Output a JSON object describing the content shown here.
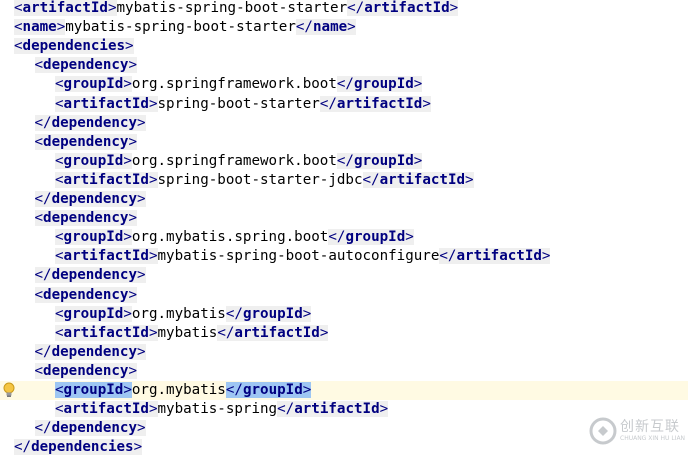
{
  "editor": {
    "lines": [
      {
        "indent": 0,
        "open": "artifactId",
        "text": "mybatis-spring-boot-starter",
        "close": "artifactId"
      },
      {
        "indent": 0,
        "open": "name",
        "text": "mybatis-spring-boot-starter",
        "close": "name"
      },
      {
        "indent": 0,
        "open": "dependencies"
      },
      {
        "indent": 1,
        "open": "dependency"
      },
      {
        "indent": 2,
        "open": "groupId",
        "text": "org.springframework.boot",
        "close": "groupId"
      },
      {
        "indent": 2,
        "open": "artifactId",
        "text": "spring-boot-starter",
        "close": "artifactId"
      },
      {
        "indent": 1,
        "close": "dependency"
      },
      {
        "indent": 1,
        "open": "dependency"
      },
      {
        "indent": 2,
        "open": "groupId",
        "text": "org.springframework.boot",
        "close": "groupId"
      },
      {
        "indent": 2,
        "open": "artifactId",
        "text": "spring-boot-starter-jdbc",
        "close": "artifactId"
      },
      {
        "indent": 1,
        "close": "dependency"
      },
      {
        "indent": 1,
        "open": "dependency"
      },
      {
        "indent": 2,
        "open": "groupId",
        "text": "org.mybatis.spring.boot",
        "close": "groupId"
      },
      {
        "indent": 2,
        "open": "artifactId",
        "text": "mybatis-spring-boot-autoconfigure",
        "close": "artifactId"
      },
      {
        "indent": 1,
        "close": "dependency"
      },
      {
        "indent": 1,
        "open": "dependency"
      },
      {
        "indent": 2,
        "open": "groupId",
        "text": "org.mybatis",
        "close": "groupId"
      },
      {
        "indent": 2,
        "open": "artifactId",
        "text": "mybatis",
        "close": "artifactId"
      },
      {
        "indent": 1,
        "close": "dependency"
      },
      {
        "indent": 1,
        "open": "dependency"
      },
      {
        "indent": 2,
        "open": "groupId",
        "text": "org.mybatis",
        "close": "groupId",
        "current": true,
        "bulb": true,
        "match": true
      },
      {
        "indent": 2,
        "open": "artifactId",
        "text": "mybatis-spring",
        "close": "artifactId"
      },
      {
        "indent": 1,
        "close": "dependency"
      },
      {
        "indent": 0,
        "close": "dependencies"
      }
    ],
    "colors": {
      "tag": "#000080",
      "tag_bg": "#efefef",
      "current_line": "#fffae3",
      "match_highlight": "#9ec6f3"
    },
    "gutter_icon": "lightbulb-icon"
  },
  "watermark": {
    "icon": "logo-icon",
    "cn": "创新互联",
    "en": "CHUANG XIN HU LIAN"
  }
}
